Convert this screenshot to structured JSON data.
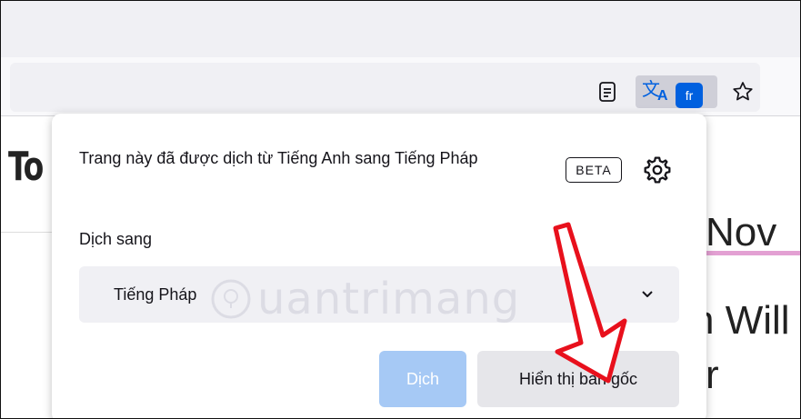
{
  "browser": {
    "translate_badge": "fr",
    "icons": [
      "reader-view-icon",
      "translate-icon",
      "bookmark-star-icon"
    ]
  },
  "page": {
    "logo_fragment": "To",
    "text_fragment_1": "Nov",
    "text_fragment_2": "n Will",
    "text_fragment_3": "r",
    "accent_line_color": "#e3a0d3"
  },
  "translation_panel": {
    "title": "Trang này đã được dịch từ Tiếng Anh sang Tiếng Pháp",
    "beta_label": "BETA",
    "settings_icon": "gear-icon",
    "target_label": "Dịch sang",
    "target_language": "Tiếng Pháp",
    "translate_button": "Dịch",
    "show_original_button": "Hiển thị bản gốc"
  },
  "watermark": {
    "text": "uantrimang"
  },
  "colors": {
    "accent": "#0060df",
    "disabled_primary": "#a6c9f5",
    "annotation_arrow": "#e8101c"
  }
}
